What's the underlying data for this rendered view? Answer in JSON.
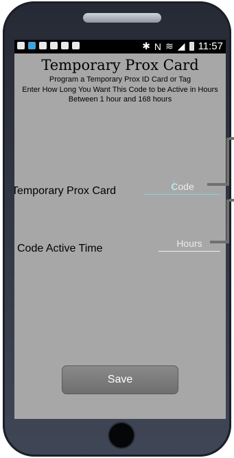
{
  "status_bar": {
    "time": "11:57",
    "icons": [
      "message-icon",
      "chat-icon",
      "gallery-icon",
      "flipboard-icon",
      "flipboard-icon",
      "mail-icon",
      "bluetooth-icon",
      "nfc-icon",
      "mute-icon",
      "wifi-icon",
      "signal-icon",
      "battery-icon"
    ]
  },
  "header": {
    "title": "Temporary Prox Card",
    "subtitle_line1": "Program a Temporary Prox ID Card or Tag",
    "subtitle_line2": "Enter How Long You Want This Code to be Active in Hours",
    "subtitle_line3": "Between 1 hour and 168 hours"
  },
  "form": {
    "card_label": "Temporary Prox Card",
    "card_placeholder": "Code",
    "time_label": "Code Active Time",
    "time_placeholder": "Hours"
  },
  "actions": {
    "save_label": "Save"
  },
  "colors": {
    "screen_bg": "#a7a7a7",
    "focus_accent": "#7fd9da",
    "button_bg": "#7d7d7d"
  }
}
